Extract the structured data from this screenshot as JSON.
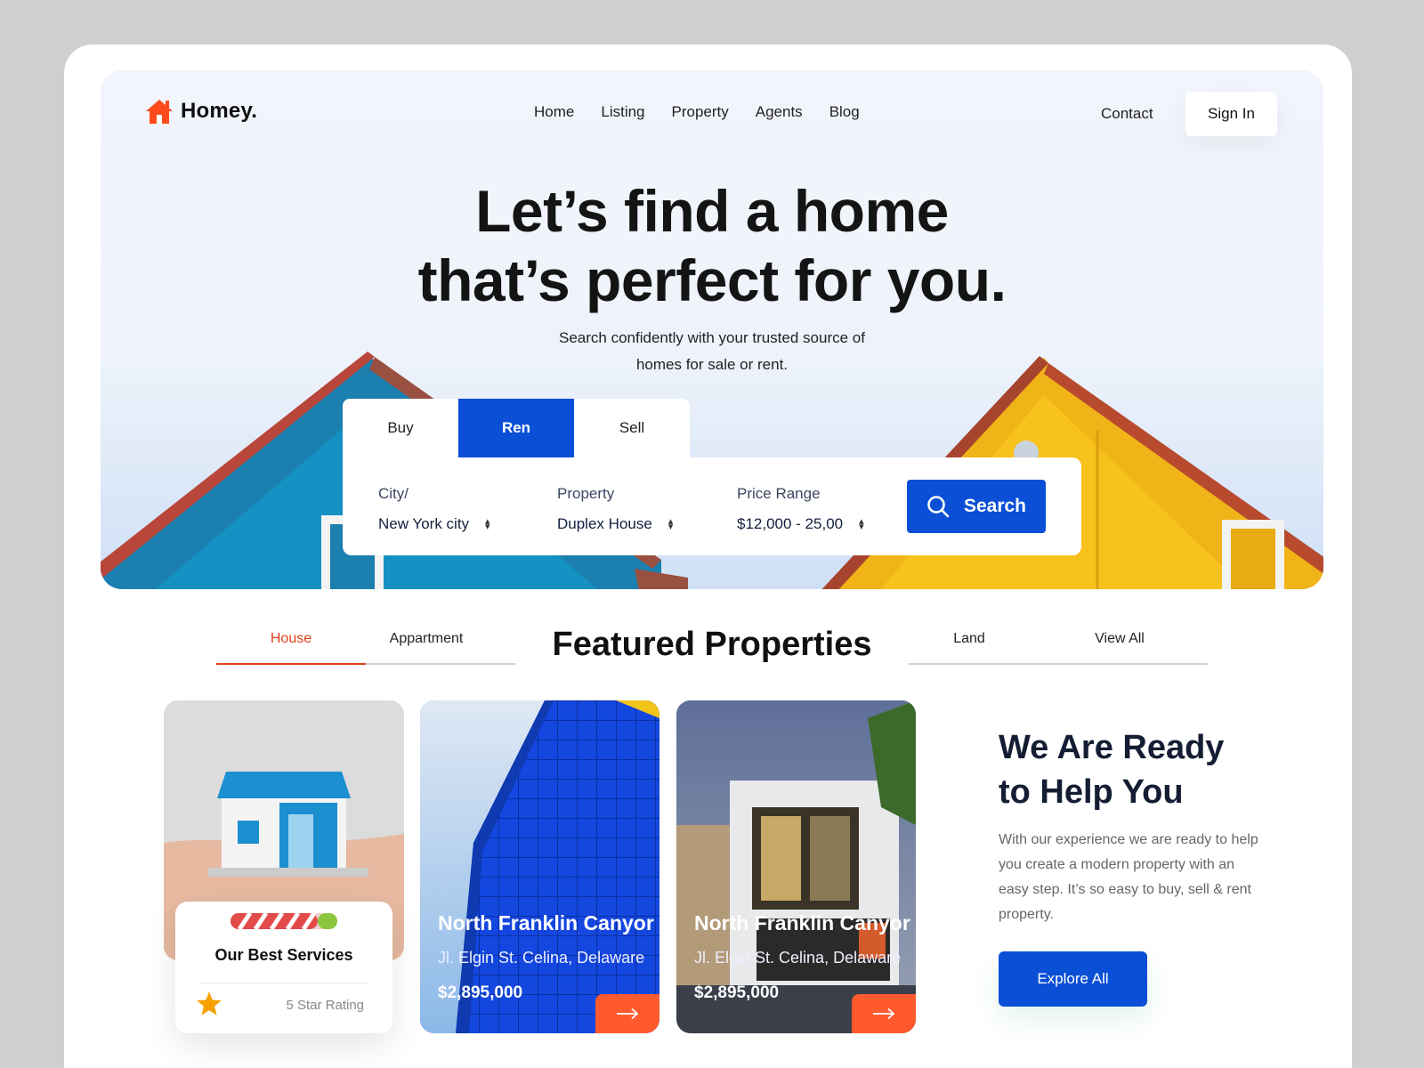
{
  "brand": {
    "name": "Homey.",
    "accent": "#ff4a1c",
    "primary": "#0a4fd6"
  },
  "nav": {
    "items": [
      "Home",
      "Listing",
      "Property",
      "Agents",
      "Blog"
    ],
    "contact": "Contact",
    "signin": "Sign In"
  },
  "hero": {
    "title_line1": "Let’s find a home",
    "title_line2": "that’s perfect for you.",
    "subtitle_line1": "Search confidently with your trusted source of",
    "subtitle_line2": "homes for sale or rent."
  },
  "search": {
    "tabs": [
      "Buy",
      "Ren",
      "Sell"
    ],
    "active_tab": "Ren",
    "city_label": "City/",
    "city_value": "New York city",
    "property_label": "Property",
    "property_value": "Duplex House",
    "price_label": "Price Range",
    "price_value": "$12,000 - 25,00",
    "button": "Search"
  },
  "featured": {
    "title": "Featured Properties",
    "tabs": [
      "House",
      "Appartment",
      "Land",
      "View All"
    ],
    "active_tab": "House"
  },
  "services_card": {
    "title": "Our Best Services",
    "rating_text": "5 Star Rating"
  },
  "listings": [
    {
      "name": "North Franklin Canyor",
      "address": "Jl. Elgin St. Celina, Delaware",
      "price": "$2,895,000"
    },
    {
      "name": "North Franklin Canyor",
      "address": "Jl. Elgin St. Celina, Delaware",
      "price": "$2,895,000"
    }
  ],
  "help": {
    "title_line1": "We Are Ready",
    "title_line2": "to Help You",
    "text": "With our experience we are ready to help you create a modern property with an easy step. It’s so easy to buy, sell & rent property.",
    "button": "Explore All"
  }
}
